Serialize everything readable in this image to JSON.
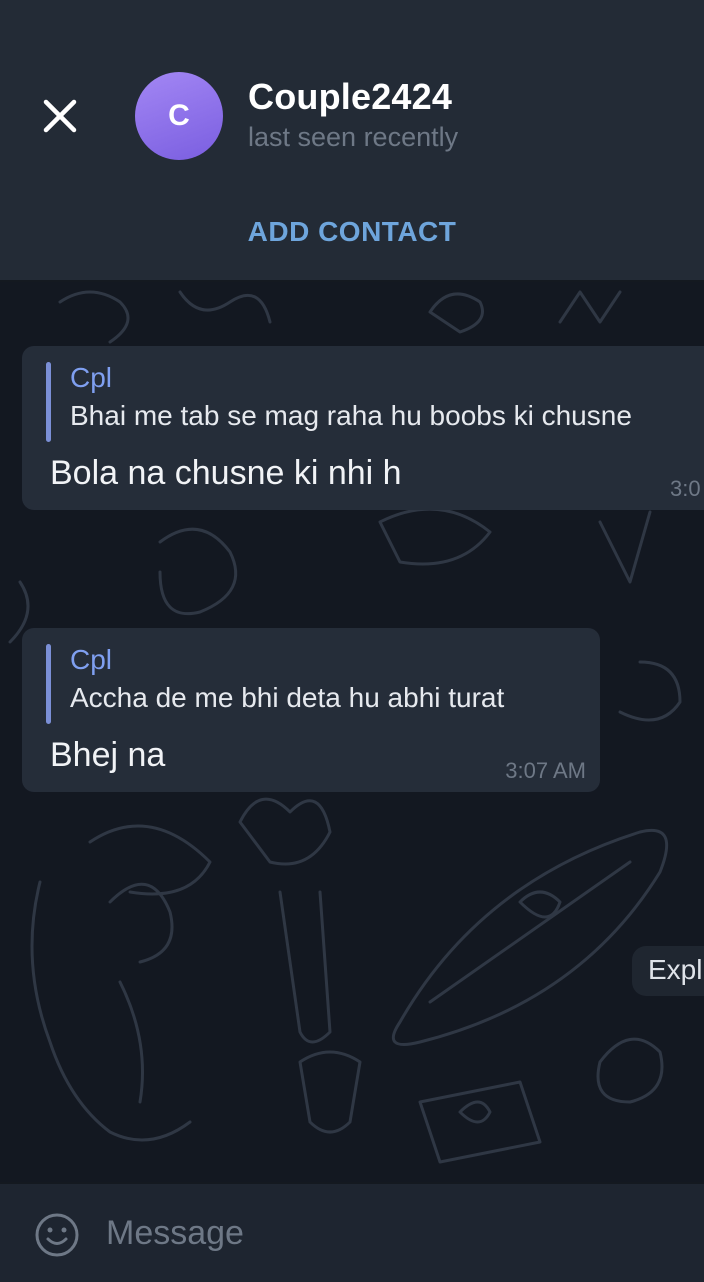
{
  "header": {
    "title": "Couple2424",
    "status": "last seen recently",
    "avatar_letter": "C"
  },
  "actions": {
    "add_contact": "ADD CONTACT"
  },
  "messages": [
    {
      "reply_name": "Cpl",
      "reply_text": "Bhai me tab se mag raha hu boobs ki chusne",
      "text": "Bola na chusne ki nhi h",
      "time": "3:0"
    },
    {
      "reply_name": "Cpl",
      "reply_text": "Accha de me bhi deta hu abhi turat",
      "text": "Bhej na",
      "time": "3:07 AM"
    }
  ],
  "side_label": "Expl",
  "composer": {
    "placeholder": "Message"
  },
  "icons": {
    "close": "close-icon",
    "emoji": "emoji-icon"
  },
  "colors": {
    "accent": "#6ea5dc",
    "avatar": "#8e70ea",
    "bubble": "#252d39",
    "background": "#131821"
  }
}
